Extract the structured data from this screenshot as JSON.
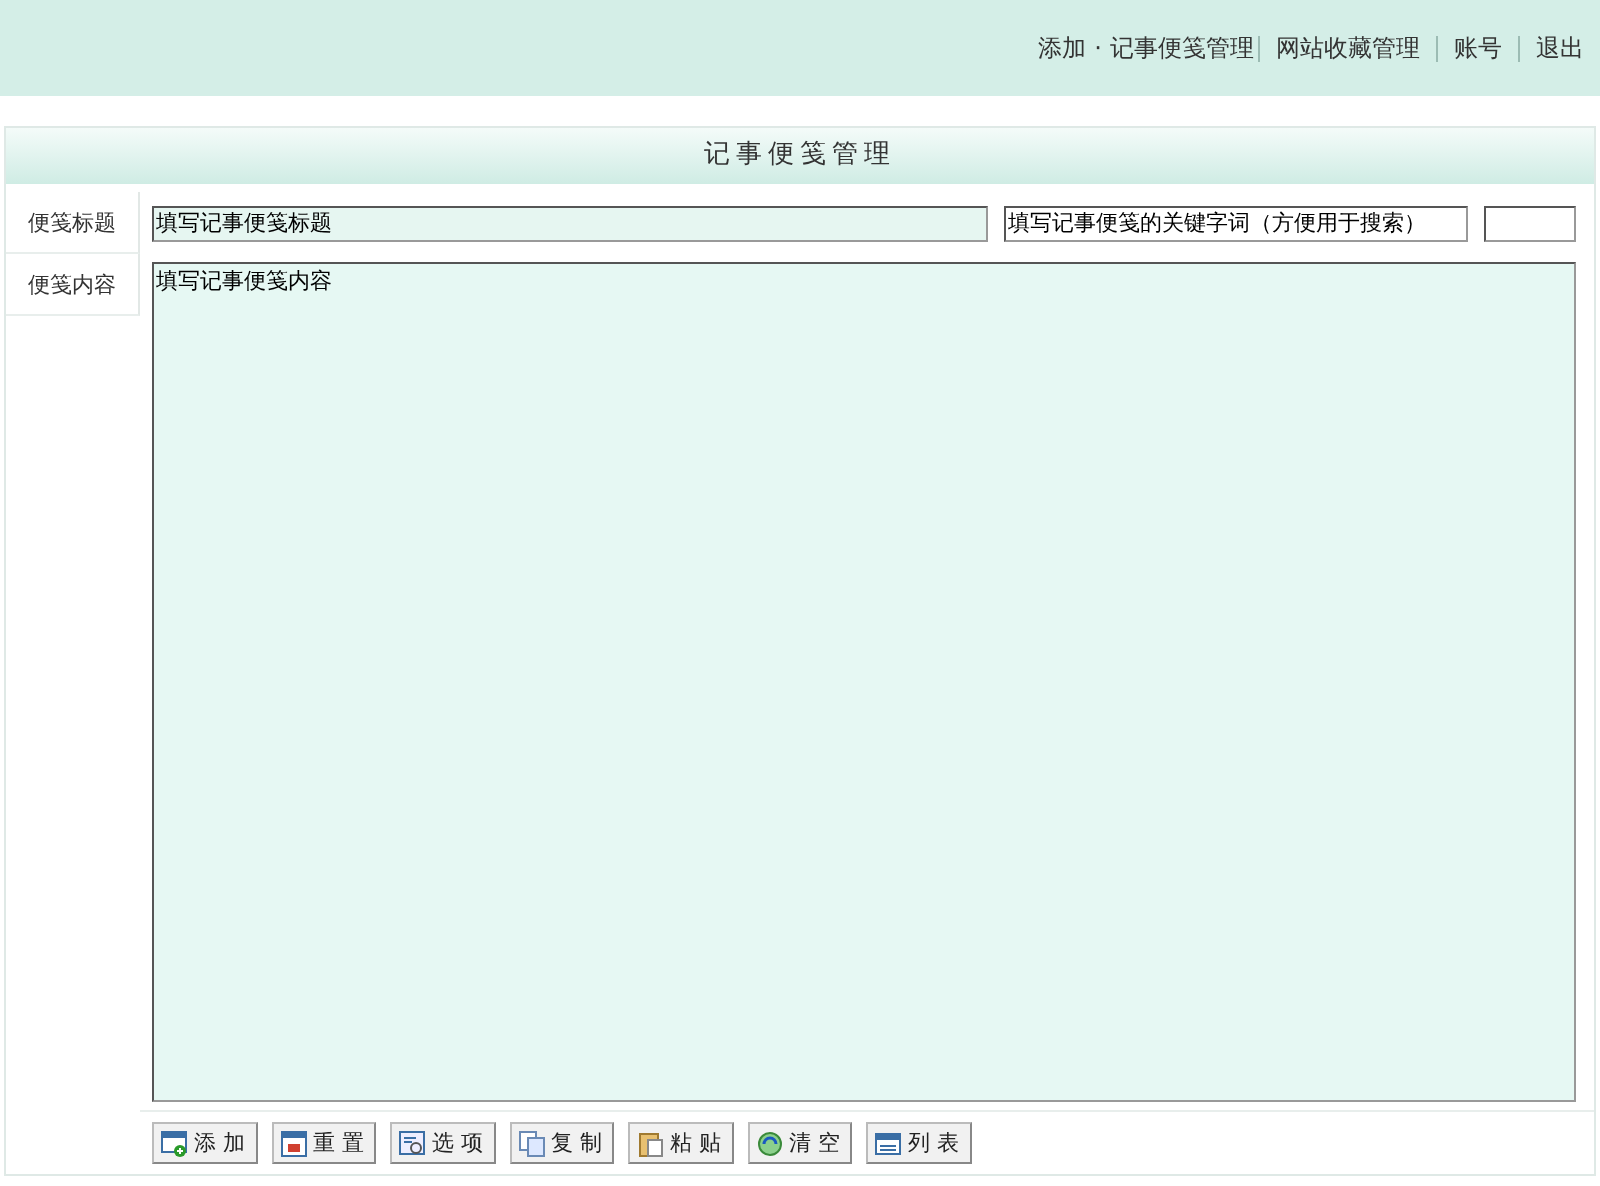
{
  "header": {
    "breadcrumb": [
      "添加",
      "记事便笺管理"
    ],
    "breadcrumb_separator": "·",
    "links": [
      "网站收藏管理",
      "账号",
      "退出"
    ]
  },
  "panel": {
    "title": "记事便笺管理",
    "title_label": "便笺标题",
    "title_value": "填写记事便笺标题",
    "keywords_value": "填写记事便笺的关键字词（方便用于搜索）",
    "content_label": "便笺内容",
    "content_value": "填写记事便笺内容"
  },
  "toolbar": [
    "添 加",
    "重 置",
    "选 项",
    "复 制",
    "粘 贴",
    "清 空",
    "列 表"
  ]
}
